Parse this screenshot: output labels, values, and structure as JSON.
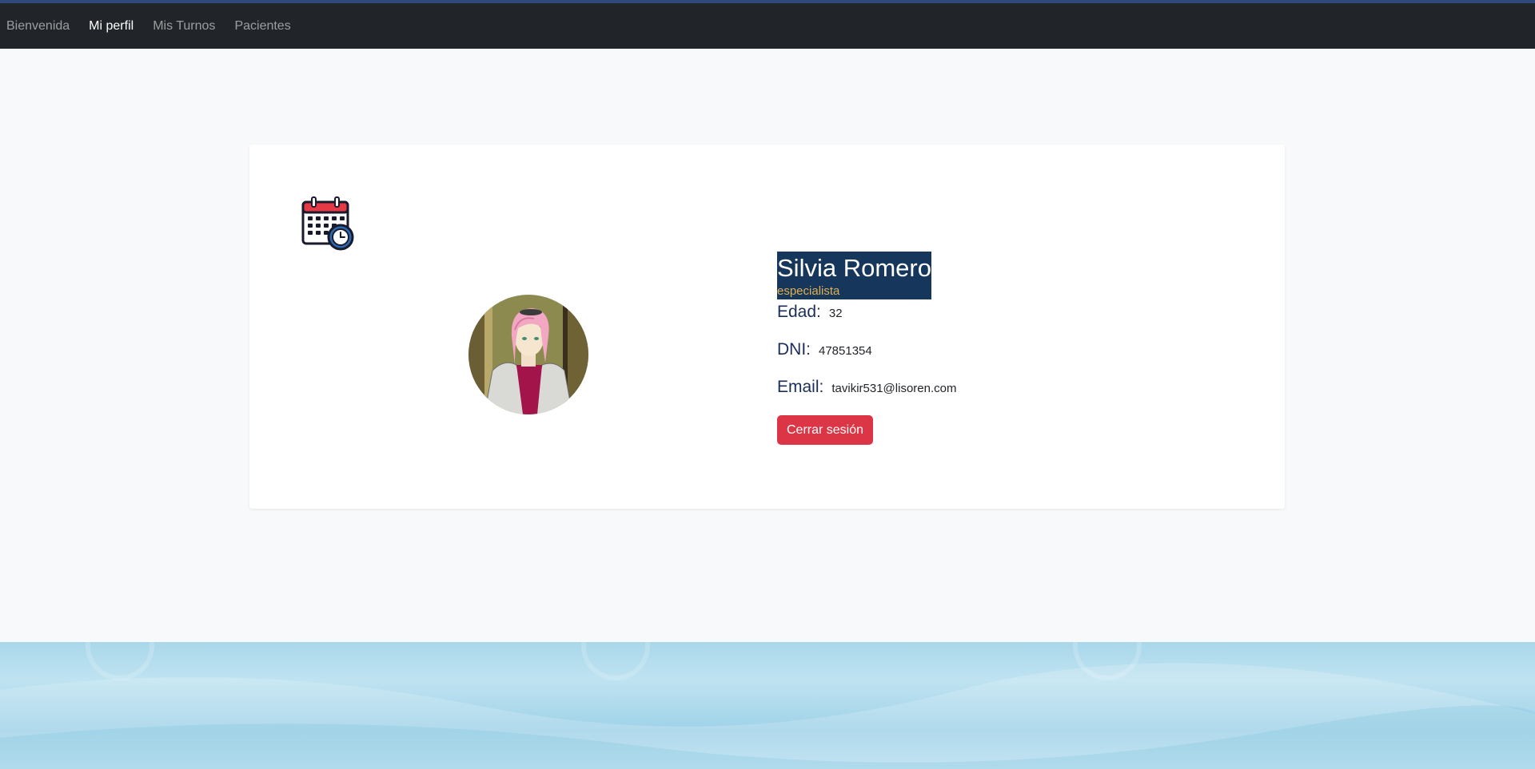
{
  "nav": {
    "items": [
      {
        "label": "Bienvenida",
        "active": false
      },
      {
        "label": "Mi perfil",
        "active": true
      },
      {
        "label": "Mis Turnos",
        "active": false
      },
      {
        "label": "Pacientes",
        "active": false
      }
    ]
  },
  "profile": {
    "name": "Silvia Romero",
    "role": "especialista",
    "fields": [
      {
        "label": "Edad:",
        "value": "32"
      },
      {
        "label": "DNI:",
        "value": "47851354"
      },
      {
        "label": "Email:",
        "value": "tavikir531@lisoren.com"
      }
    ],
    "logout_label": "Cerrar sesión"
  },
  "icons": {
    "turnos": "calendar-clock-icon",
    "avatar": "profile-photo"
  },
  "colors": {
    "navbar": "#212529",
    "name_highlight": "#16365c",
    "role": "#e2b04a",
    "logout": "#dc3545"
  }
}
